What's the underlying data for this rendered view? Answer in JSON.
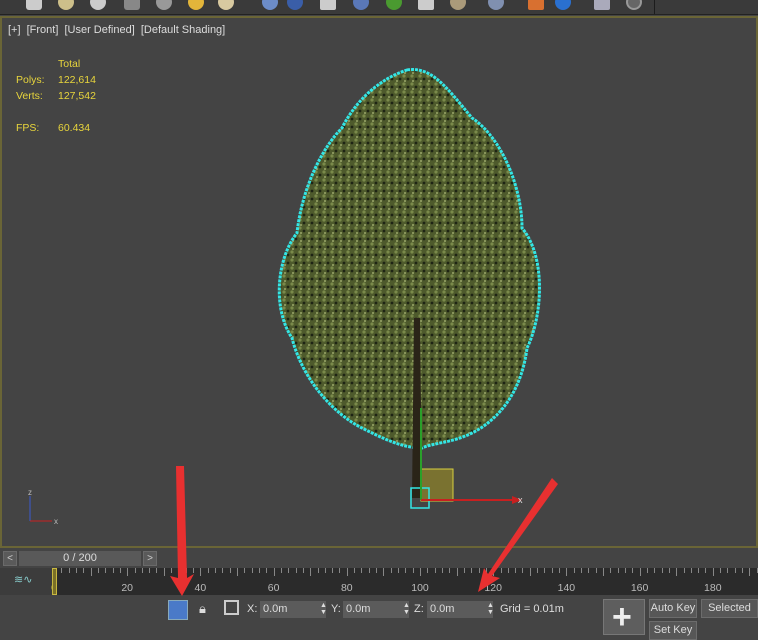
{
  "viewport": {
    "labels": [
      "[+]",
      "[Front]",
      "[User Defined]",
      "[Default Shading]"
    ],
    "stats": {
      "header": "Total",
      "polys_label": "Polys:",
      "polys": "122,614",
      "verts_label": "Verts:",
      "verts": "127,542",
      "fps_label": "FPS:",
      "fps": "60.434"
    },
    "selection_color": "#33e6e6",
    "stats_color": "#e8d53c"
  },
  "timeline": {
    "prev": "<",
    "next": ">",
    "frame": "0 / 200",
    "current_frame": 0,
    "total_frames": 200,
    "ticks": [
      "0",
      "20",
      "40",
      "60",
      "80",
      "100",
      "120",
      "140",
      "160",
      "180"
    ]
  },
  "status": {
    "x_label": "X:",
    "x": "0.0m",
    "y_label": "Y:",
    "y": "0.0m",
    "z_label": "Z:",
    "z": "0.0m",
    "grid": "Grid = 0.01m",
    "auto_key": "Auto Key",
    "selected": "Selected",
    "set_key": "Set Key"
  },
  "annotation_color": "#e83030"
}
